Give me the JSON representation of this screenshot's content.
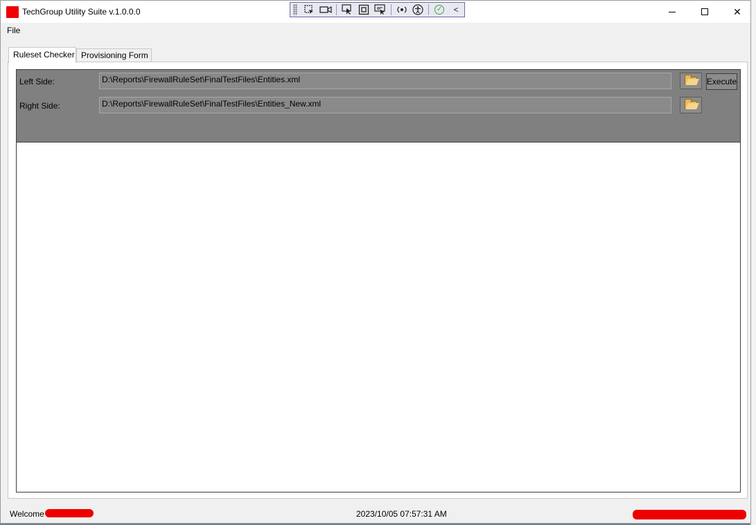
{
  "window": {
    "title": "TechGroup Utility Suite  v.1.0.0.0",
    "minimize_icon": "minimize-icon",
    "maximize_icon": "maximize-icon",
    "close_icon": "close-icon",
    "close_glyph": "✕"
  },
  "debug_toolbar": {
    "icons": [
      "grip-icon",
      "select-element-icon",
      "record-icon",
      "pointer-icon",
      "track-element-icon",
      "display-layout-icon",
      "hot-reload-icon",
      "accessibility-icon",
      "check-icon",
      "collapse-icon"
    ],
    "collapse_glyph": "<",
    "check_glyph": "✓"
  },
  "menu": {
    "file_label": "File"
  },
  "tabs": [
    {
      "label": "Ruleset Checker",
      "active": true
    },
    {
      "label": "Provisioning Form",
      "active": false
    }
  ],
  "ruleset": {
    "left_label": "Left Side:",
    "left_path": "D:\\Reports\\FirewallRuleSet\\FinalTestFiles\\Entities.xml",
    "right_label": "Right Side:",
    "right_path": "D:\\Reports\\FirewallRuleSet\\FinalTestFiles\\Entities_New.xml",
    "browse_icon": "folder-open-icon",
    "execute_label": "Execute"
  },
  "status": {
    "welcome_label": "Welcome",
    "timestamp": "2023/10/05 07:57:31 AM"
  }
}
